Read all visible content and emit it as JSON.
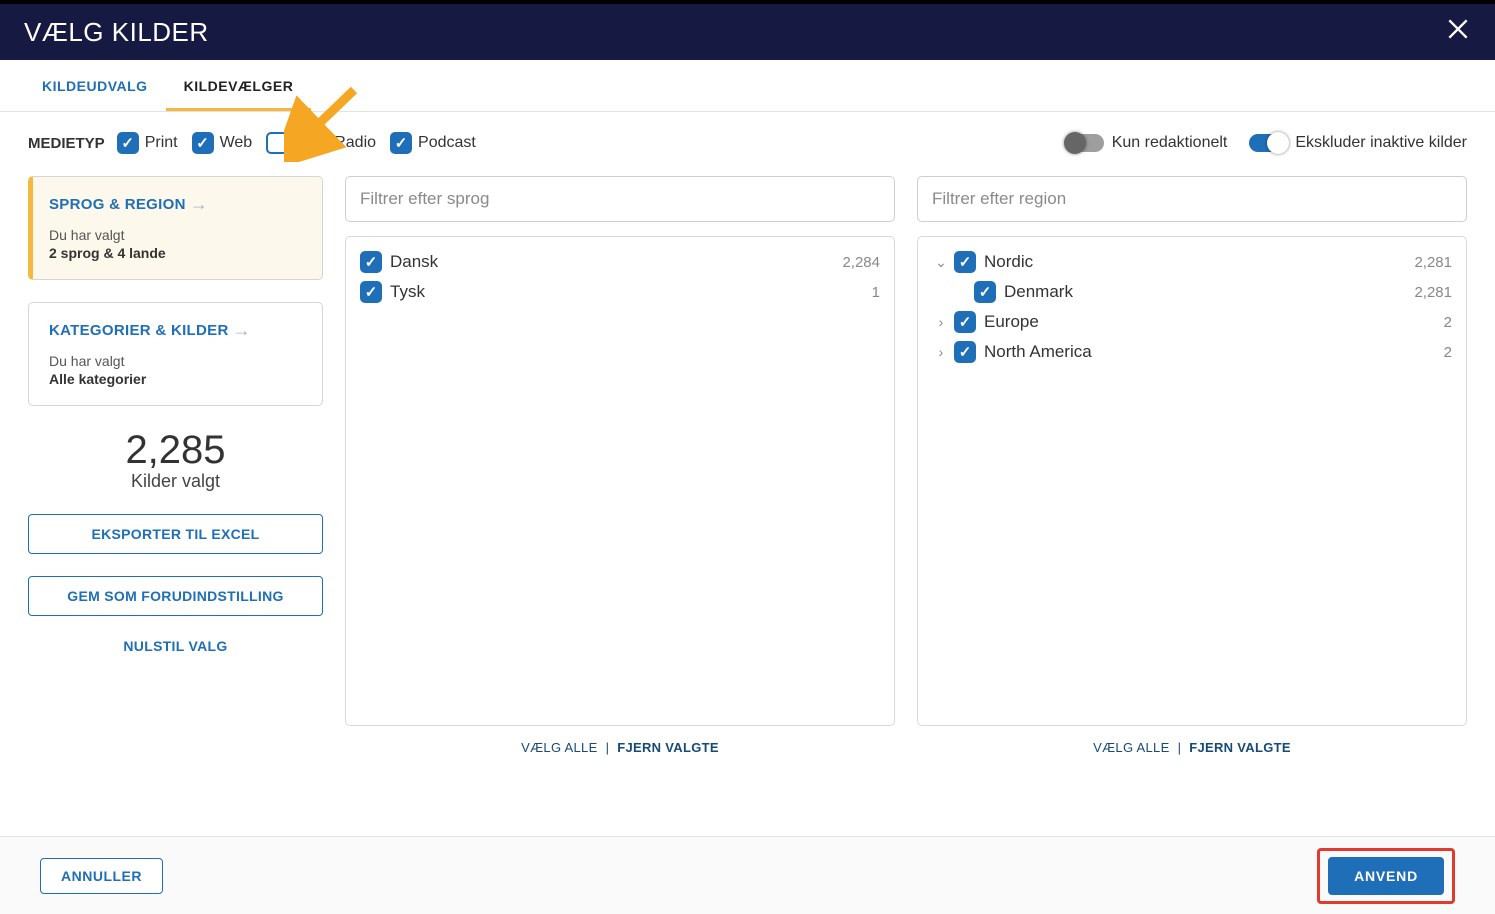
{
  "header": {
    "title": "VÆLG KILDER"
  },
  "tabs": {
    "t0": "KILDEUDVALG",
    "t1": "KILDEVÆLGER"
  },
  "mediatype": {
    "label": "MEDIETYP",
    "print": "Print",
    "web": "Web",
    "tvradio": "TV & Radio",
    "podcast": "Podcast"
  },
  "toggles": {
    "editorial": "Kun redaktionelt",
    "exclude": "Ekskluder inaktive kilder"
  },
  "side": {
    "card1": {
      "title": "SPROG & REGION",
      "sub1": "Du har valgt",
      "sub2": "2 sprog & 4 lande"
    },
    "card2": {
      "title": "KATEGORIER & KILDER",
      "sub1": "Du har valgt",
      "sub2": "Alle kategorier"
    },
    "count_n": "2,285",
    "count_l": "Kilder valgt",
    "export": "EKSPORTER TIL EXCEL",
    "preset": "GEM SOM FORUDINDSTILLING",
    "reset": "NULSTIL VALG"
  },
  "lang": {
    "placeholder": "Filtrer efter sprog",
    "items": [
      {
        "label": "Dansk",
        "count": "2,284"
      },
      {
        "label": "Tysk",
        "count": "1"
      }
    ]
  },
  "region": {
    "placeholder": "Filtrer efter region",
    "items": {
      "nordic": {
        "label": "Nordic",
        "count": "2,281"
      },
      "denmark": {
        "label": "Denmark",
        "count": "2,281"
      },
      "europe": {
        "label": "Europe",
        "count": "2"
      },
      "na": {
        "label": "North America",
        "count": "2"
      }
    }
  },
  "sel": {
    "all": "VÆLG ALLE",
    "remove": "FJERN VALGTE"
  },
  "footer": {
    "cancel": "ANNULLER",
    "apply": "ANVEND"
  }
}
